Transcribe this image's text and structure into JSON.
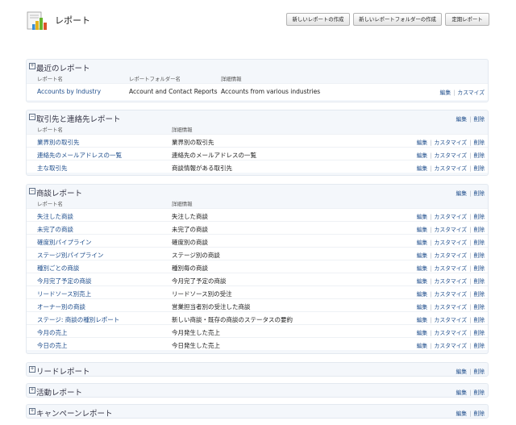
{
  "header": {
    "title": "レポート",
    "buttons": [
      "新しいレポートの作成",
      "新しいレポートフォルダーの作成",
      "定期レポート"
    ]
  },
  "actions": {
    "edit": "編集",
    "customize": "カスマイズ",
    "customize_table": "カスタマイズ",
    "delete": "削除"
  },
  "recent": {
    "title": "最近のレポート",
    "columns": [
      "レポート名",
      "レポートフォルダー名",
      "詳細情報"
    ],
    "row": {
      "name": "Accounts by Industry",
      "folder": "Account and Contact Reports",
      "detail": "Accounts from various industries"
    }
  },
  "accounts": {
    "title": "取引先と連絡先レポート",
    "columns": [
      "レポート名",
      "詳細情報"
    ],
    "rows": [
      {
        "name": "業界別の取引先",
        "detail": "業界別の取引先"
      },
      {
        "name": "連絡先のメールアドレスの一覧",
        "detail": "連絡先のメールアドレスの一覧"
      },
      {
        "name": "主な取引先",
        "detail": "商談情報がある取引先"
      }
    ]
  },
  "opps": {
    "title": "商談レポート",
    "columns": [
      "レポート名",
      "詳細情報"
    ],
    "rows": [
      {
        "name": "失注した商談",
        "detail": "失注した商談"
      },
      {
        "name": "未完了の商談",
        "detail": "未完了の商談"
      },
      {
        "name": "確度別パイプライン",
        "detail": "確度別の商談"
      },
      {
        "name": "ステージ別パイプライン",
        "detail": "ステージ別の商談"
      },
      {
        "name": "種別ごとの商談",
        "detail": "種別毎の商談"
      },
      {
        "name": "今月完了予定の商談",
        "detail": "今月完了予定の商談"
      },
      {
        "name": "リードソース別売上",
        "detail": "リードソース別の受注"
      },
      {
        "name": "オーナー別の商談",
        "detail": "営業担当者別の受注した商談"
      },
      {
        "name": "ステージ: 商談の種別レポート",
        "detail": "新しい商談・既存の商談のステータスの要約"
      },
      {
        "name": "今月の売上",
        "detail": "今月発生した売上"
      },
      {
        "name": "今日の売上",
        "detail": "今日発生した売上"
      }
    ]
  },
  "collapsed": [
    "リードレポート",
    "活動レポート",
    "キャンペーンレポート"
  ]
}
